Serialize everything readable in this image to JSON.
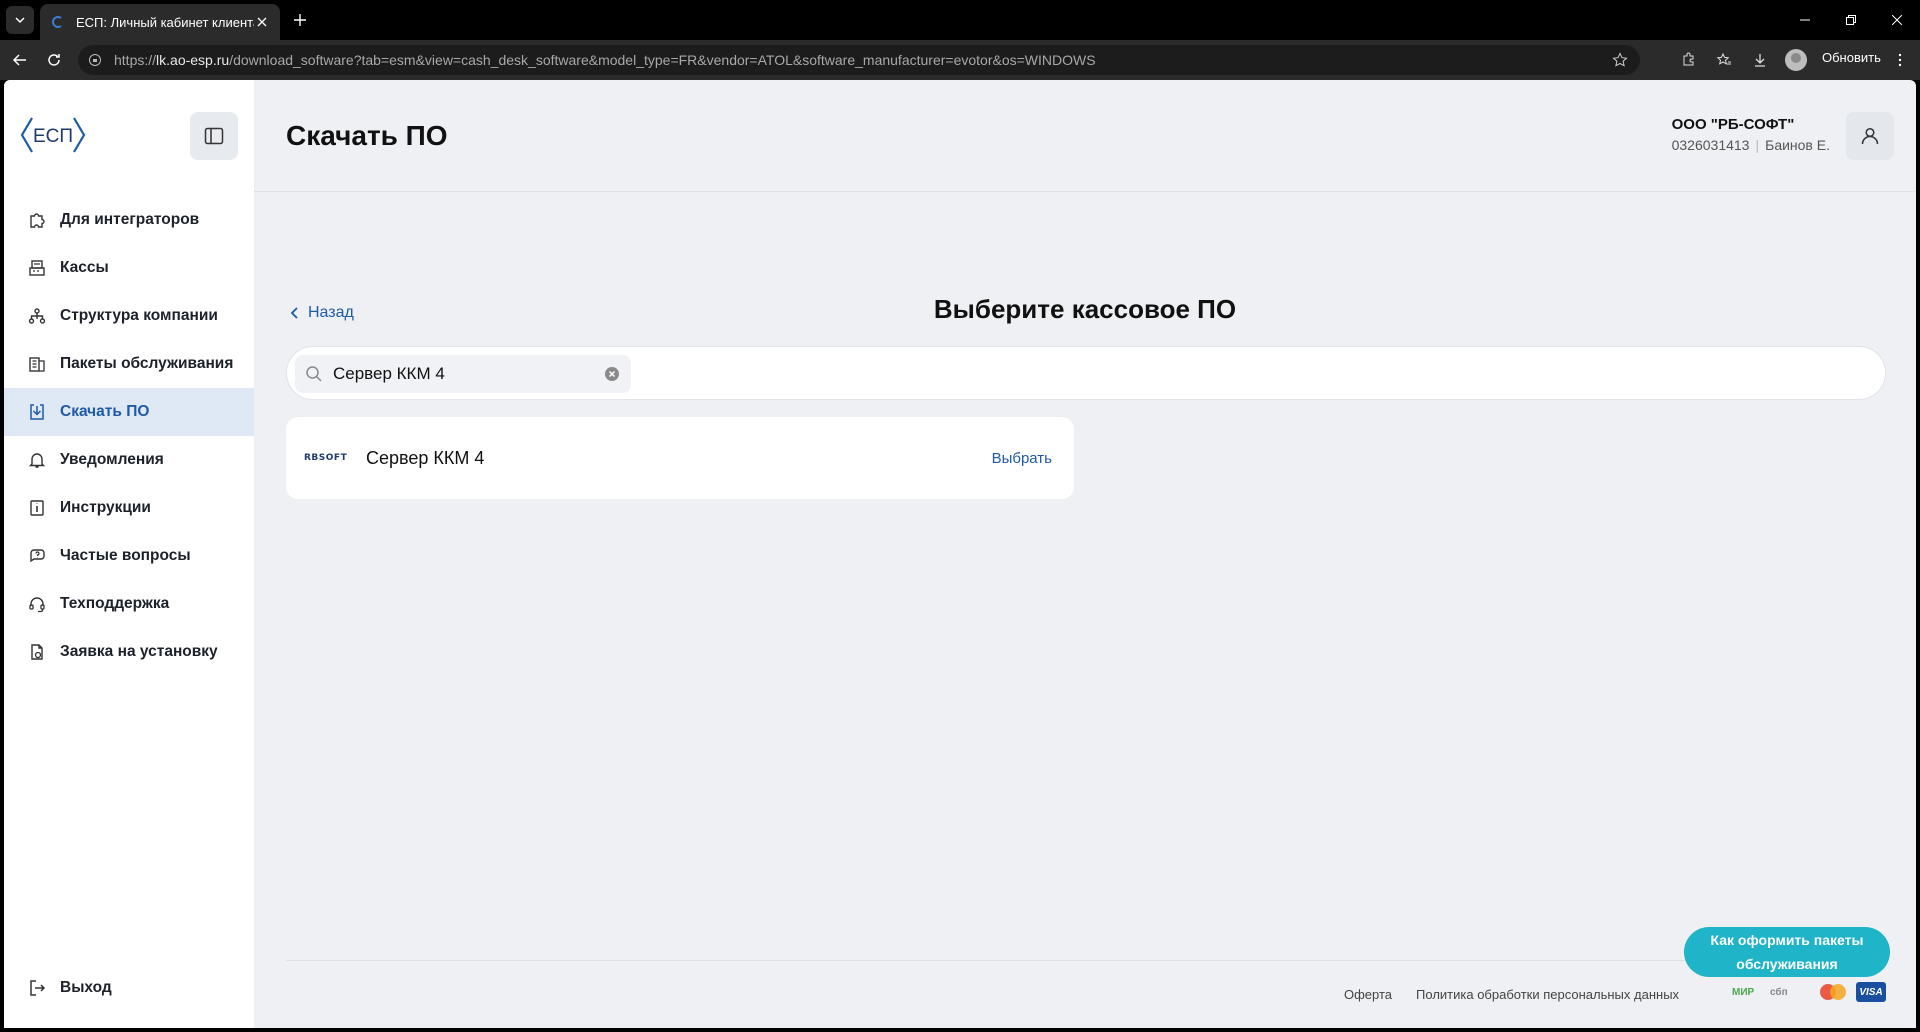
{
  "browser": {
    "tab_title": "ЕСП: Личный кабинет клиента",
    "url_prefix": "https://",
    "url_host": "lk.ao-esp.ru",
    "url_path": "/download_software?tab=esm&view=cash_desk_software&model_type=FR&vendor=ATOL&software_manufacturer=evotor&os=WINDOWS",
    "update_label": "Обновить"
  },
  "sidebar": {
    "logo_text": "ЕСП",
    "items": [
      {
        "label": "Для интеграторов",
        "icon": "puzzle-icon"
      },
      {
        "label": "Кассы",
        "icon": "cash-register-icon"
      },
      {
        "label": "Структура компании",
        "icon": "hierarchy-icon"
      },
      {
        "label": "Пакеты обслуживания",
        "icon": "package-icon"
      },
      {
        "label": "Скачать ПО",
        "icon": "download-icon",
        "active": true
      },
      {
        "label": "Уведомления",
        "icon": "bell-icon"
      },
      {
        "label": "Инструкции",
        "icon": "info-book-icon"
      },
      {
        "label": "Частые вопросы",
        "icon": "faq-icon"
      },
      {
        "label": "Техподдержка",
        "icon": "headset-icon"
      },
      {
        "label": "Заявка на установку",
        "icon": "request-icon"
      }
    ],
    "logout_label": "Выход"
  },
  "header": {
    "title": "Скачать ПО",
    "org_name": "ООО \"РБ-СОФТ\"",
    "inn": "0326031413",
    "user_name": "Баинов Е."
  },
  "main": {
    "back_label": "Назад",
    "heading": "Выберите кассовое ПО",
    "search": {
      "value": "Сервер ККМ 4"
    },
    "results": [
      {
        "vendor_logo": "RBSOFT",
        "name": "Сервер ККМ 4",
        "action": "Выбрать"
      }
    ]
  },
  "footer": {
    "links": [
      "Оферта",
      "Политика обработки персональных данных"
    ],
    "payments": [
      "МИР",
      "сбп",
      "Mastercard",
      "VISA"
    ],
    "help_button": "Как оформить пакеты обслуживания"
  },
  "colors": {
    "accent": "#1f5aa6",
    "active_bg": "#dfe8f5",
    "help_button": "#1fb4c8",
    "page_bg": "#eef0f3"
  }
}
